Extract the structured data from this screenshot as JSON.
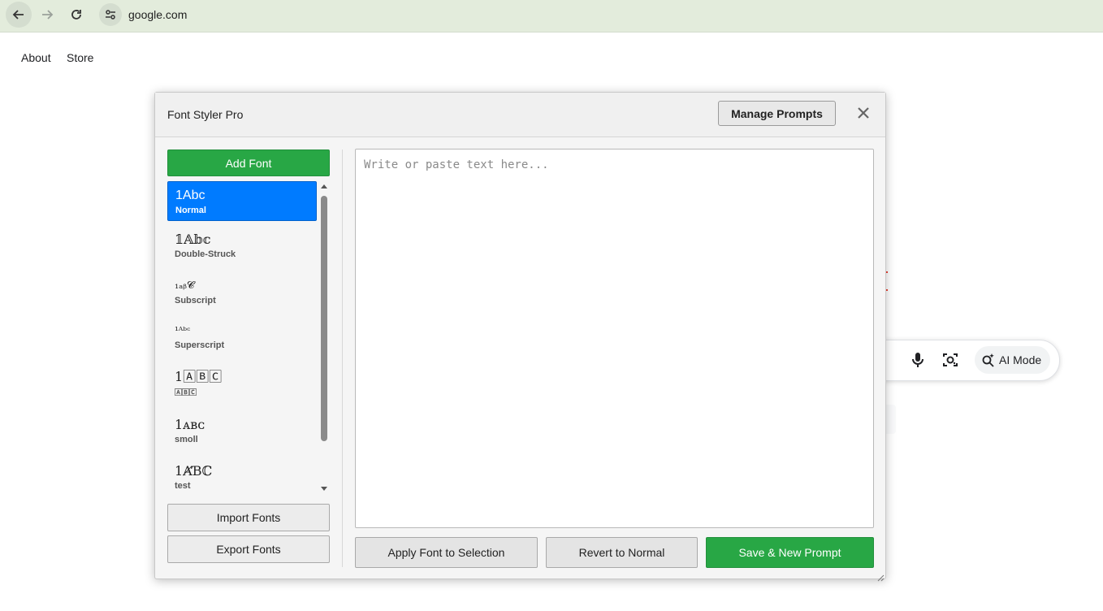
{
  "browser": {
    "url": "google.com"
  },
  "google": {
    "links": {
      "about": "About",
      "store": "Store"
    },
    "ai_mode_label": "AI Mode"
  },
  "dialog": {
    "title": "Font Styler Pro",
    "manage_prompts_label": "Manage Prompts",
    "add_font_label": "Add Font",
    "fonts": [
      {
        "sample": "1Abc",
        "name": "Normal",
        "selected": true
      },
      {
        "sample": "𝟙𝔸𝕓𝕔",
        "name": "Double-Struck"
      },
      {
        "sample": "₁ₐᵦ𝓒",
        "name": "Subscript"
      },
      {
        "sample": "¹ᴬᵇᶜ",
        "name": "Superscript"
      },
      {
        "sample": "1🄰🄱🄲",
        "name": "🄰🄱🄲"
      },
      {
        "sample": "1ᴀʙᴄ",
        "name": "smoll"
      },
      {
        "sample": "1ȺƁℂ",
        "name": "test"
      }
    ],
    "import_label": "Import Fonts",
    "export_label": "Export Fonts",
    "editor_placeholder": "Write or paste text here...",
    "apply_label": "Apply Font to Selection",
    "revert_label": "Revert to Normal",
    "save_label": "Save & New Prompt",
    "colors": {
      "accent_green": "#28a745",
      "selected_blue": "#007bff"
    }
  }
}
